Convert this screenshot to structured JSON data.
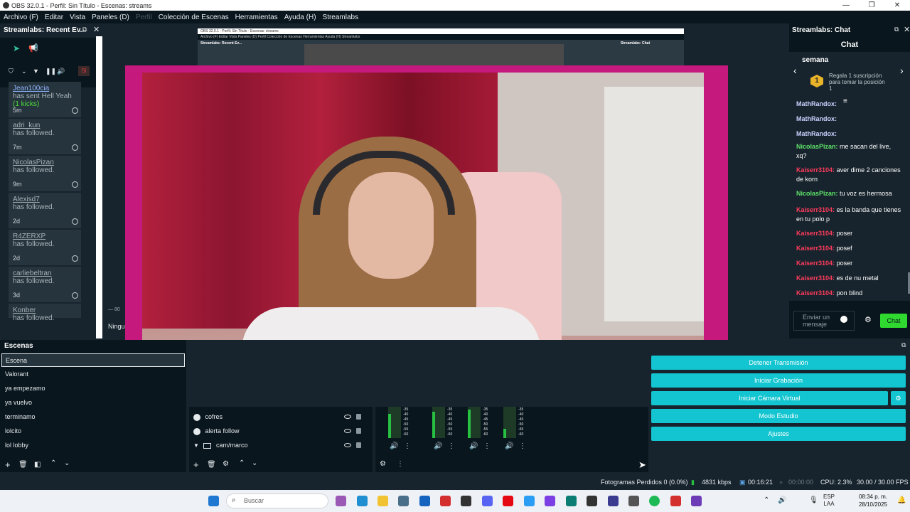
{
  "window": {
    "title": "OBS 32.0.1 - Perfil: Sin Título - Escenas: streams",
    "controls": [
      "—",
      "❐",
      "✕"
    ]
  },
  "menu": [
    "Archivo (F)",
    "Editar",
    "Vista",
    "Paneles (D)",
    "Perfil",
    "Colección de Escenas",
    "Herramientas",
    "Ayuda (H)",
    "Streamlabs"
  ],
  "events_dock": {
    "title": "Streamlabs: Recent Ev...",
    "items": [
      {
        "user": "Jean100cia",
        "text": "has sent Hell Yeah",
        "extra": "(1 kicks)",
        "time": "5m"
      },
      {
        "user": "adri_kun",
        "text": "has followed.",
        "time": "7m"
      },
      {
        "user": "NicolasPizan",
        "text": "has followed.",
        "time": "9m"
      },
      {
        "user": "Alexisd7",
        "text": "has followed.",
        "time": "2d"
      },
      {
        "user": "R4ZERXP",
        "text": "has followed.",
        "time": "2d"
      },
      {
        "user": "carliebeltran",
        "text": "has followed.",
        "time": "3d"
      },
      {
        "user": "Konber",
        "text": "has followed.",
        "time": ""
      }
    ]
  },
  "preview": {
    "mini_title": "OBS 32.0.1 - Perfil: Sin Título - Escenas: streams",
    "mini_menu": "Archivo (F)   Editar   Vista   Paneles (D)   Perfil   Colección de Escenas   Herramientas   Ayuda (H)   Streamlabs",
    "mini_left": "Streamlabs: Recent Ev...",
    "mini_right": "Streamlabs: Chat",
    "partial_text": "Ningu",
    "partial_num": "— 80"
  },
  "chat_dock": {
    "title": "Streamlabs: Chat",
    "tab": "Chat",
    "week": "semana",
    "gift_text": "Regala 1 suscripción para tomar la posición 1",
    "rank": "1",
    "messages": [
      {
        "user": "MathRandox:",
        "text": "",
        "color": "#c9d1ff"
      },
      {
        "user": "MathRandox:",
        "text": "",
        "color": "#c9d1ff"
      },
      {
        "user": "MathRandox:",
        "text": "",
        "color": "#c9d1ff"
      },
      {
        "user": "NicolasPizan:",
        "text": "me sacan del live, xq?",
        "color": "#5fe36a"
      },
      {
        "user": "Kaiserr3104:",
        "text": "aver dime 2 canciones de korn",
        "color": "#ff3b5c"
      },
      {
        "user": "NicolasPizan:",
        "text": "tu voz es hermosa",
        "color": "#5fe36a"
      },
      {
        "user": "Kaiserr3104:",
        "text": "es la banda que tienes en tu polo p",
        "color": "#ff3b5c"
      },
      {
        "user": "Kaiserr3104:",
        "text": "poser",
        "color": "#ff3b5c"
      },
      {
        "user": "Kaiserr3104:",
        "text": "posef",
        "color": "#ff3b5c"
      },
      {
        "user": "Kaiserr3104:",
        "text": "poser",
        "color": "#ff3b5c"
      },
      {
        "user": "Kaiserr3104:",
        "text": "es de nu metal",
        "color": "#ff3b5c"
      },
      {
        "user": "Kaiserr3104:",
        "text": "pon blind",
        "color": "#ff3b5c"
      }
    ],
    "input_placeholder": "Enviar un mensaje",
    "send_label": "Chat"
  },
  "scenes": {
    "title": "Escenas",
    "items": [
      "Escena",
      "Valorant",
      "ya empezamo",
      "ya vuelvo",
      "terminamo",
      "lolcito",
      "lol lobby"
    ],
    "selected": 0
  },
  "sources": {
    "items": [
      {
        "name": "cofres",
        "icon": "image-icon"
      },
      {
        "name": "alerta follow",
        "icon": "browser-icon"
      },
      {
        "name": "cam/marco",
        "icon": "folder-icon"
      }
    ]
  },
  "mixer": {
    "scale": [
      "-35",
      "-40",
      "-45",
      "-50",
      "-55",
      "-60"
    ],
    "channels": [
      {
        "level": 0.78
      },
      {
        "level": 0.85
      },
      {
        "level": 0.9
      },
      {
        "level": 0.3
      }
    ]
  },
  "controls": {
    "buttons": [
      "Detener Transmisión",
      "Iniciar Grabación",
      "Iniciar Cámara Virtual",
      "Modo Estudio",
      "Ajustes"
    ],
    "accent": "#13c5d0"
  },
  "status": {
    "dropped": "Fotogramas Perdidos 0 (0.0%)",
    "bitrate": "4831 kbps",
    "live_time": "00:16:21",
    "rec_time": "00:00:00",
    "cpu": "CPU: 2.3%",
    "fps": "30.00 / 30.00 FPS"
  },
  "taskbar": {
    "search_placeholder": "Buscar",
    "lang": "ESP",
    "region": "LAA",
    "time": "08:34 p. m.",
    "date": "28/10/2025"
  }
}
